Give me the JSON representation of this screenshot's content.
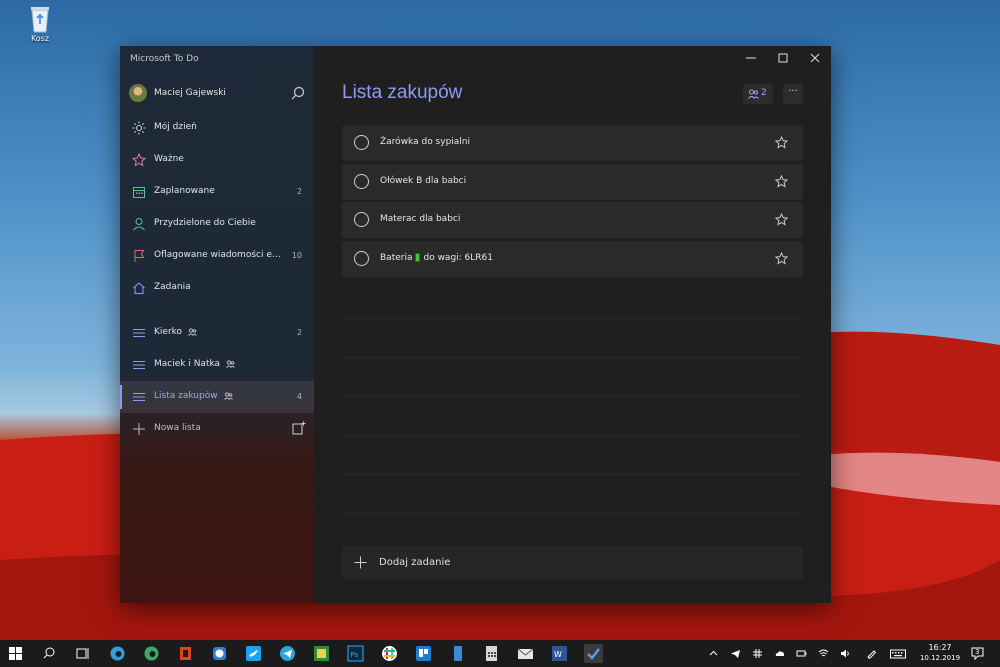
{
  "desktop": {
    "recycle_bin_label": "Kosz"
  },
  "app": {
    "title": "Microsoft To Do"
  },
  "user": {
    "name": "Maciej Gajewski"
  },
  "sidebar": {
    "smart_lists": [
      {
        "label": "Mój dzień",
        "count": "",
        "icon": "sun-icon"
      },
      {
        "label": "Ważne",
        "count": "",
        "icon": "star-icon"
      },
      {
        "label": "Zaplanowane",
        "count": "2",
        "icon": "calendar-icon"
      },
      {
        "label": "Przydzielone do Ciebie",
        "count": "",
        "icon": "person-icon"
      },
      {
        "label": "Oflagowane wiadomości e-mail",
        "count": "10",
        "icon": "flag-icon"
      },
      {
        "label": "Zadania",
        "count": "",
        "icon": "home-icon"
      }
    ],
    "lists": [
      {
        "label": "Kierko",
        "count": "2",
        "shared": true
      },
      {
        "label": "Maciek i Natka",
        "count": "",
        "shared": true
      },
      {
        "label": "Lista zakupów",
        "count": "4",
        "shared": true
      }
    ],
    "new_list_label": "Nowa lista"
  },
  "main": {
    "title": "Lista zakupów",
    "share_count": "2",
    "more_label": "···",
    "tasks": [
      {
        "title": "Żarówka do sypialni"
      },
      {
        "title": "Ołówek B dla babci"
      },
      {
        "title": "Materac dla babci"
      },
      {
        "title_before": "Bateria",
        "title_after": "do wagi: 6LR61"
      }
    ],
    "add_task_label": "Dodaj zadanie"
  },
  "taskbar": {
    "time": "16:27",
    "date": "10.12.2019",
    "notification_count": "3"
  },
  "colors": {
    "accent": "#8e9cf2",
    "window_bg": "#1f1f1f",
    "task_bg": "#2a2a2a"
  }
}
